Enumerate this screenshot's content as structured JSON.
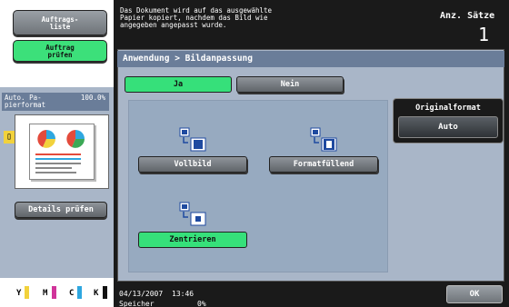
{
  "left_panel": {
    "jobs_button": "Auftrags-\nliste",
    "check_job_button": "Auftrag\nprüfen",
    "paper_label": "Auto. Pa-\npierformat",
    "zoom": "100.0%",
    "details_button": "Details prüfen",
    "toner": [
      "Y",
      "M",
      "C",
      "K"
    ],
    "toner_colors": [
      "#f2d23c",
      "#d0349a",
      "#2ea7e0",
      "#111111"
    ]
  },
  "header": {
    "message": "Das Dokument wird auf das ausgewählte\nPapier kopiert, nachdem das Bild wie\nangegeben angepasst wurde.",
    "sets_label": "Anz. Sätze",
    "sets_value": "1"
  },
  "breadcrumb": "Anwendung > Bildanpassung",
  "toggle": {
    "yes": "Ja",
    "no": "Nein"
  },
  "options": {
    "full_image": "Vollbild",
    "fit_format": "Formatfüllend",
    "center": "Zentrieren"
  },
  "original_format": {
    "label": "Originalformat",
    "value": "Auto"
  },
  "status": {
    "date": "04/13/2007",
    "time": "13:46",
    "memory_label": "Speicher",
    "memory_value": "0%"
  },
  "ok_button": "OK",
  "colors": {
    "accent_green": "#36e07a",
    "panel_blue": "#a9b6c8",
    "header_blue": "#6a7d99",
    "dark_bg": "#1a1a1a"
  }
}
